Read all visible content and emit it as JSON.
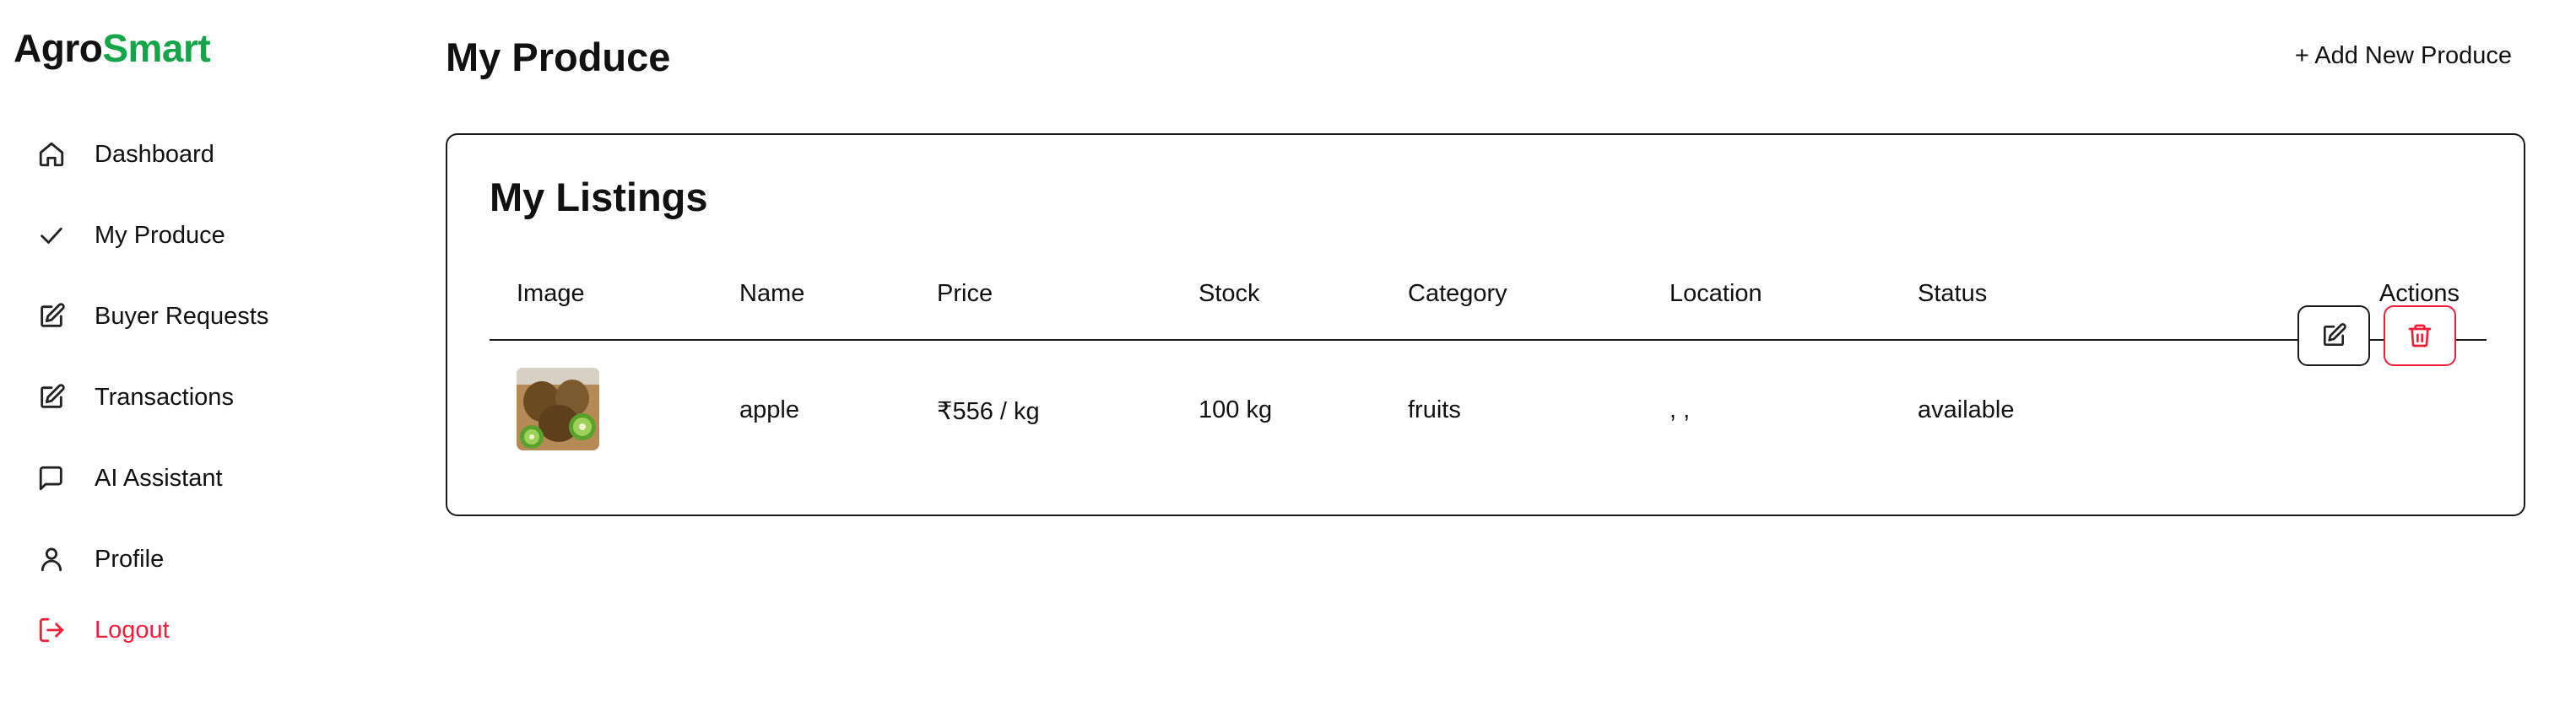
{
  "app": {
    "name_part1": "Agro",
    "name_part2": "Smart",
    "brand_color": "#16a34a"
  },
  "sidebar": {
    "items": [
      {
        "label": "Dashboard",
        "icon": "home-icon"
      },
      {
        "label": "My Produce",
        "icon": "check-icon"
      },
      {
        "label": "Buyer Requests",
        "icon": "edit-icon"
      },
      {
        "label": "Transactions",
        "icon": "edit-icon"
      },
      {
        "label": "AI Assistant",
        "icon": "message-icon"
      },
      {
        "label": "Profile",
        "icon": "user-icon"
      }
    ],
    "logout": {
      "label": "Logout",
      "icon": "logout-icon",
      "color": "#ef1f3a"
    }
  },
  "header": {
    "title": "My Produce",
    "add_label": "+ Add New Produce"
  },
  "listings": {
    "title": "My Listings",
    "columns": [
      "Image",
      "Name",
      "Price",
      "Stock",
      "Category",
      "Location",
      "Status",
      "Actions"
    ],
    "rows": [
      {
        "image": "kiwi-image",
        "name": "apple",
        "price": "₹556 / kg",
        "stock": "100 kg",
        "category": "fruits",
        "location": ", ,",
        "status": "available"
      }
    ]
  },
  "actions": {
    "edit_icon": "edit-icon",
    "delete_icon": "trash-icon",
    "delete_color": "#ef1f3a"
  }
}
